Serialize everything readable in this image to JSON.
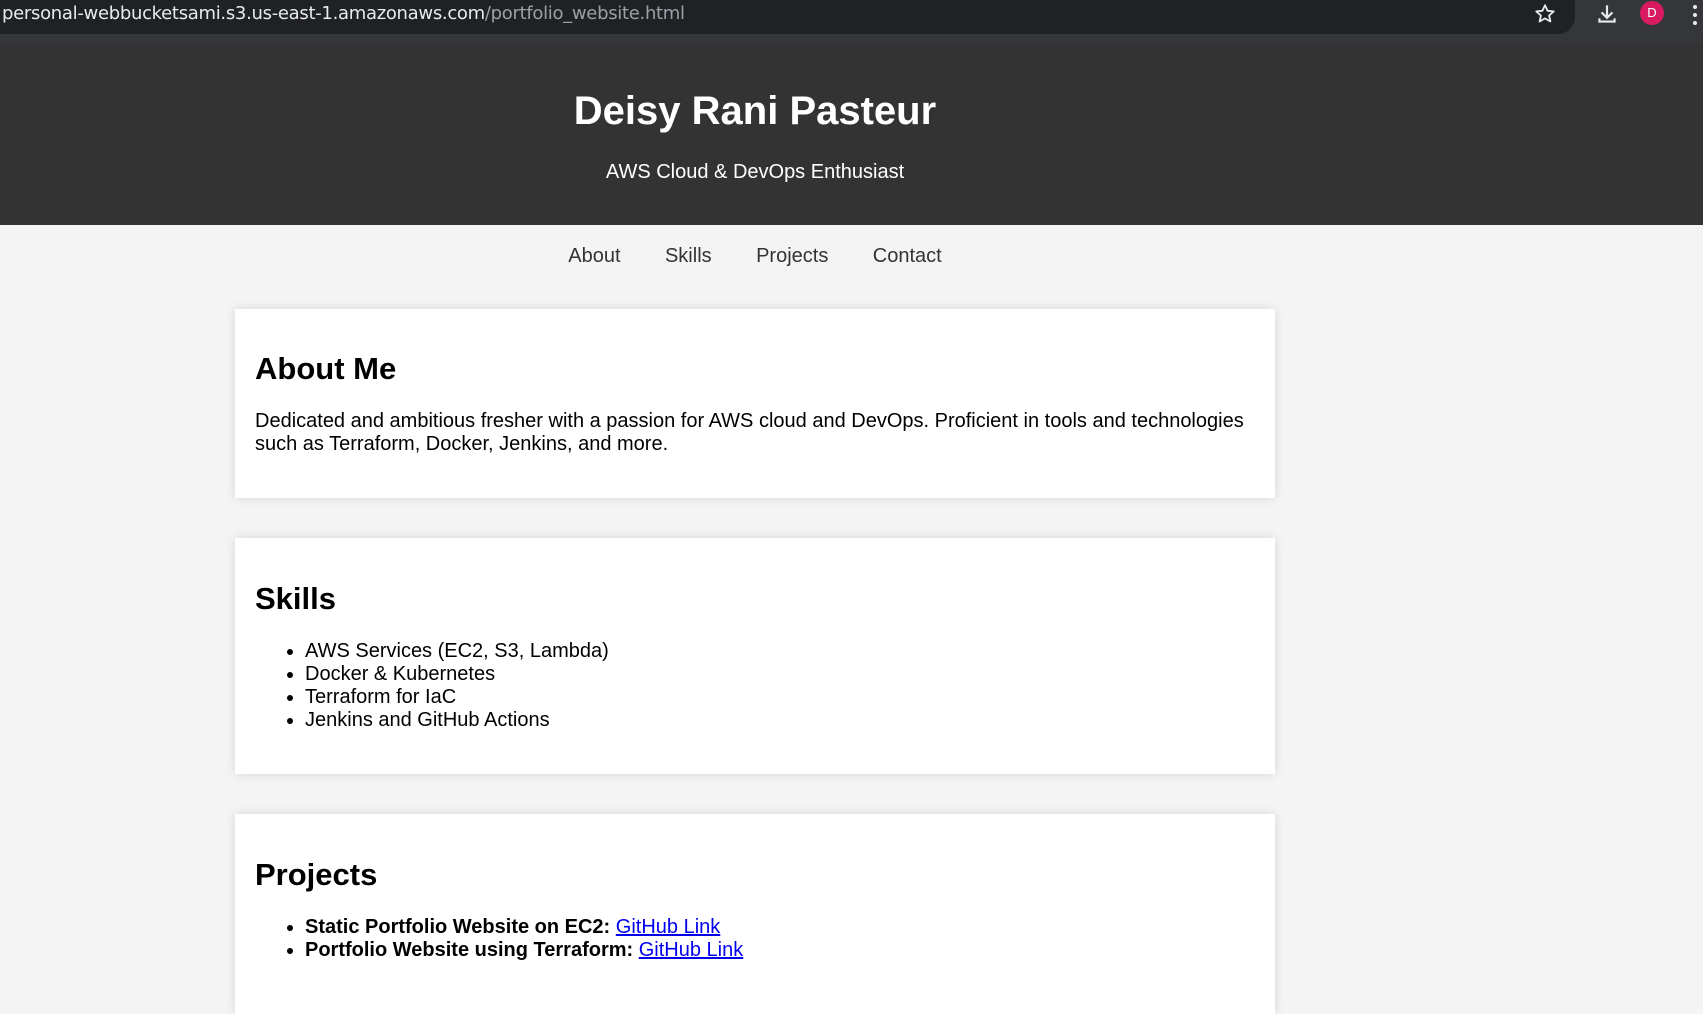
{
  "browser": {
    "url_host": "personal-webbucketsami.s3.us-east-1.amazonaws.com",
    "url_path": "/portfolio_website.html",
    "profile_initial": "D",
    "star_icon": "star-icon",
    "download_icon": "download-icon",
    "menu_icon": "kebab-menu-icon"
  },
  "header": {
    "title": "Deisy Rani Pasteur",
    "subtitle": "AWS Cloud & DevOps Enthusiast"
  },
  "nav": [
    "About",
    "Skills",
    "Projects",
    "Contact"
  ],
  "about": {
    "heading": "About Me",
    "text": "Dedicated and ambitious fresher with a passion for AWS cloud and DevOps. Proficient in tools and technologies such as Terraform, Docker, Jenkins, and more."
  },
  "skills": {
    "heading": "Skills",
    "items": [
      "AWS Services (EC2, S3, Lambda)",
      "Docker & Kubernetes",
      "Terraform for IaC",
      "Jenkins and GitHub Actions"
    ]
  },
  "projects": {
    "heading": "Projects",
    "items": [
      {
        "title": "Static Portfolio Website on EC2:",
        "link": "GitHub Link"
      },
      {
        "title": "Portfolio Website using Terraform:",
        "link": "GitHub Link"
      }
    ]
  },
  "colors": {
    "header_bg": "#333333",
    "page_bg": "#f4f4f4",
    "link": "#0000ee",
    "avatar": "#d81b60"
  }
}
